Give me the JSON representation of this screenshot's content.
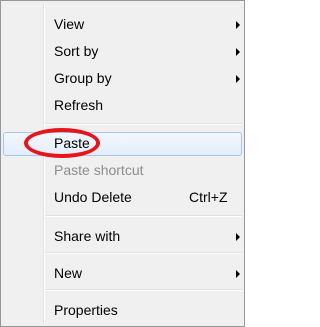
{
  "context_menu": {
    "items": [
      {
        "label": "View",
        "submenu": true
      },
      {
        "label": "Sort by",
        "submenu": true
      },
      {
        "label": "Group by",
        "submenu": true
      },
      {
        "label": "Refresh"
      },
      {
        "label": "Paste",
        "highlighted": true
      },
      {
        "label": "Paste shortcut",
        "disabled": true
      },
      {
        "label": "Undo Delete",
        "shortcut": "Ctrl+Z"
      },
      {
        "label": "Share with",
        "submenu": true
      },
      {
        "label": "New",
        "submenu": true
      },
      {
        "label": "Properties"
      }
    ]
  },
  "annotation": {
    "color": "#e8141b",
    "target": "Paste"
  }
}
